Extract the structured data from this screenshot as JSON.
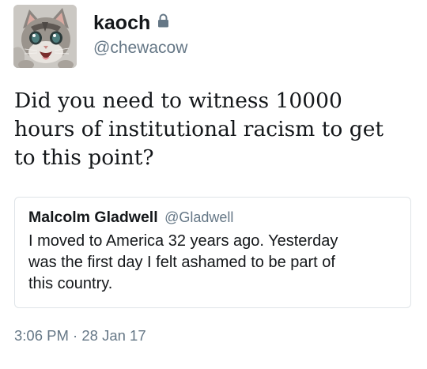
{
  "tweet": {
    "author": {
      "display_name": "kaoch",
      "handle": "@chewacow",
      "avatar_icon": "kitten-avatar",
      "protected_icon": "lock-icon"
    },
    "text": "Did you need to witness 10000\nhours of institutional racism to get\nto this point?",
    "quoted_tweet": {
      "display_name": "Malcolm Gladwell",
      "handle": "@Gladwell",
      "text": "I moved to America 32 years ago. Yesterday\nwas the first day I felt ashamed to be part of\nthis country."
    },
    "timestamp": {
      "time": "3:06 PM",
      "separator": "·",
      "date": "28 Jan 17"
    }
  },
  "colors": {
    "text_primary": "#14171a",
    "text_secondary": "#657786",
    "border": "#dfe4e8"
  }
}
